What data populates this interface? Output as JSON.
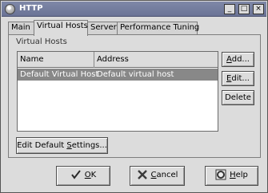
{
  "window": {
    "title": "HTTP",
    "controls": [
      "_",
      "□",
      "×"
    ]
  },
  "tabs": [
    {
      "label": "Main",
      "active": false
    },
    {
      "label": "Virtual Hosts",
      "active": true
    },
    {
      "label": "Server",
      "active": false
    },
    {
      "label": "Performance Tuning",
      "active": false
    }
  ],
  "group": {
    "label": "Virtual Hosts"
  },
  "table": {
    "columns": [
      "Name",
      "Address"
    ],
    "rows": [
      {
        "name": "Default Virtual Host",
        "address": "Default virtual host",
        "selected": true
      }
    ]
  },
  "side_buttons": {
    "add": {
      "pre": "",
      "u": "A",
      "post": "dd..."
    },
    "edit": {
      "pre": "",
      "u": "E",
      "post": "dit..."
    },
    "delete": {
      "label": "Delete"
    }
  },
  "edit_default": {
    "pre": "Edit Default ",
    "u": "S",
    "post": "ettings..."
  },
  "dialog_buttons": {
    "ok": {
      "pre": "",
      "u": "O",
      "post": "K",
      "icon": "check-icon"
    },
    "cancel": {
      "pre": "",
      "u": "C",
      "post": "ancel",
      "icon": "cancel-x-icon"
    },
    "help": {
      "pre": "",
      "u": "H",
      "post": "elp",
      "icon": "help-lifebuoy-icon"
    }
  },
  "colors": {
    "titlebar": "#6f7899",
    "selection": "#888888",
    "window_bg": "#dcdcdc"
  }
}
